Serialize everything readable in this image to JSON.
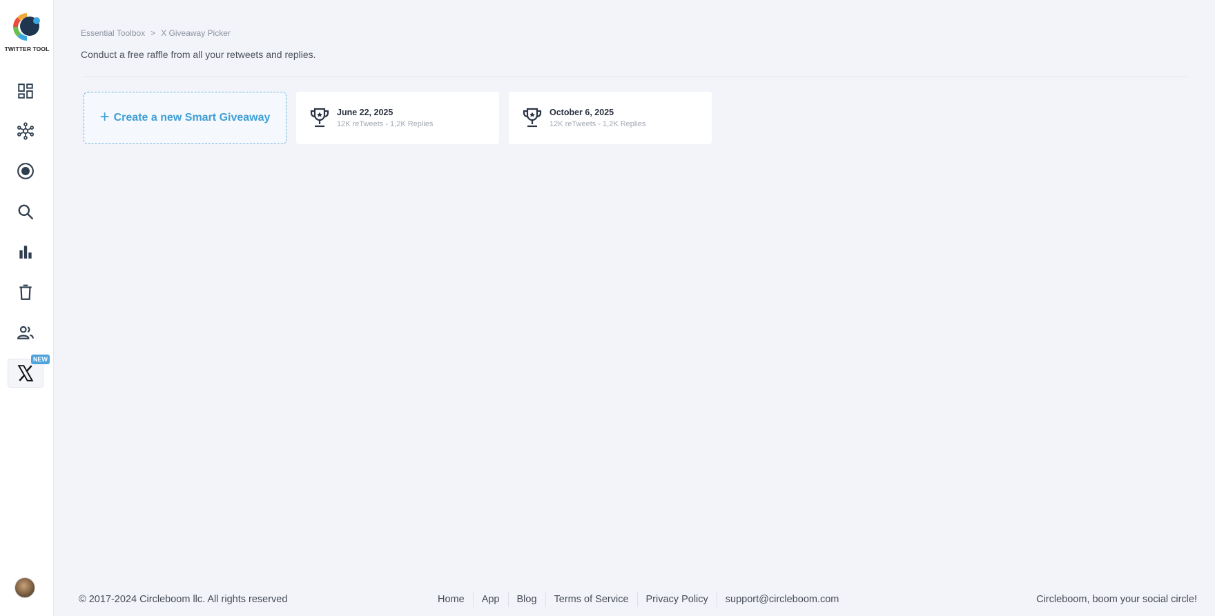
{
  "sidebar": {
    "logo_text": "TWITTER TOOL",
    "items": [
      {
        "name": "dashboard"
      },
      {
        "name": "network"
      },
      {
        "name": "record"
      },
      {
        "name": "search"
      },
      {
        "name": "analytics"
      },
      {
        "name": "delete"
      },
      {
        "name": "users"
      },
      {
        "name": "x-giveaway",
        "badge": "NEW"
      }
    ]
  },
  "header": {
    "breadcrumb": [
      "Essential Toolbox",
      ">",
      "X Giveaway Picker"
    ],
    "subtitle": "Conduct a free raffle from all your retweets and replies."
  },
  "main": {
    "create_button": {
      "icon": "+",
      "label": "Create a new Smart Giveaway"
    },
    "giveaways": [
      {
        "date": "June 22, 2025",
        "stats": "12K reTweets - 1,2K Replies"
      },
      {
        "date": "October 6, 2025",
        "stats": "12K reTweets - 1,2K Replies"
      }
    ]
  },
  "footer": {
    "copyright": "© 2017-2024 Circleboom llc. All rights reserved",
    "links": [
      "Home",
      "App",
      "Blog",
      "Terms of Service",
      "Privacy Policy",
      "support@circleboom.com"
    ],
    "tagline": "Circleboom, boom your social circle!"
  },
  "colors": {
    "accent": "#3e9fd6",
    "background": "#f2f4f9",
    "icon": "#2f3e4e"
  }
}
